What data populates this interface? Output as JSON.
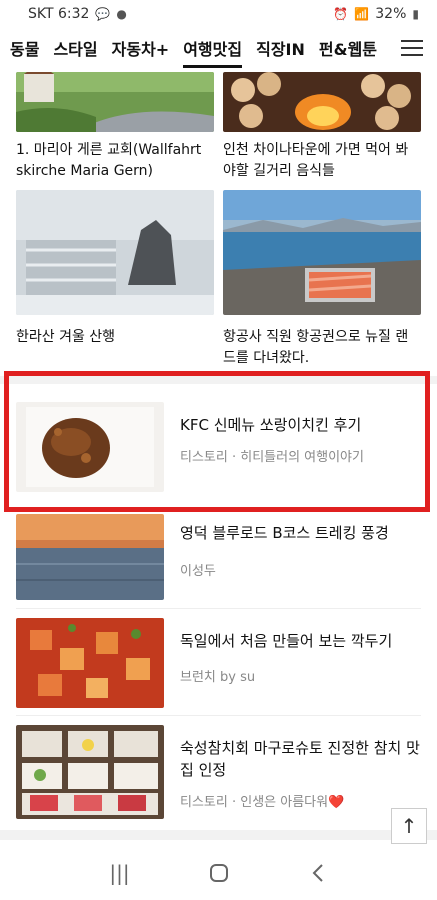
{
  "status": {
    "carrier_time": "SKT 6:32",
    "battery": "32%"
  },
  "nav": {
    "items": [
      "동물",
      "스타일",
      "자동차+",
      "여행맛집",
      "직장IN",
      "펀&웹툰"
    ],
    "active": "여행맛집"
  },
  "grid": [
    {
      "caption": "1. 마리아 게른 교회(Wallfahrt skirche Maria Gern)"
    },
    {
      "caption": "인천 차이나타운에 가면 먹어 봐야할 길거리 음식들"
    },
    {
      "caption": "한라산 겨울 산행"
    },
    {
      "caption": "항공사 직원 항공권으로 뉴질 랜드를 다녀왔다."
    }
  ],
  "list": [
    {
      "title": "KFC 신메뉴 쏘랑이치킨 후기",
      "sub": "티스토리 · 히티틀러의 여행이야기"
    },
    {
      "title": "영덕 블루로드 B코스 트레킹 풍경",
      "sub": "이성두"
    },
    {
      "title": "독일에서 처음 만들어 보는 깍두기",
      "sub": "브런치 by su"
    },
    {
      "title": "숙성참치회 마구로슈토 진정한 참치 맛집 인정",
      "sub": "티스토리 · 인생은 아름다워❤️"
    }
  ],
  "icons": {
    "menu": "hamburger-icon",
    "top": "arrow-up-icon",
    "recent": "recent-apps-icon",
    "home": "home-icon",
    "back": "back-icon"
  },
  "colors": {
    "highlight": "#e02020"
  }
}
